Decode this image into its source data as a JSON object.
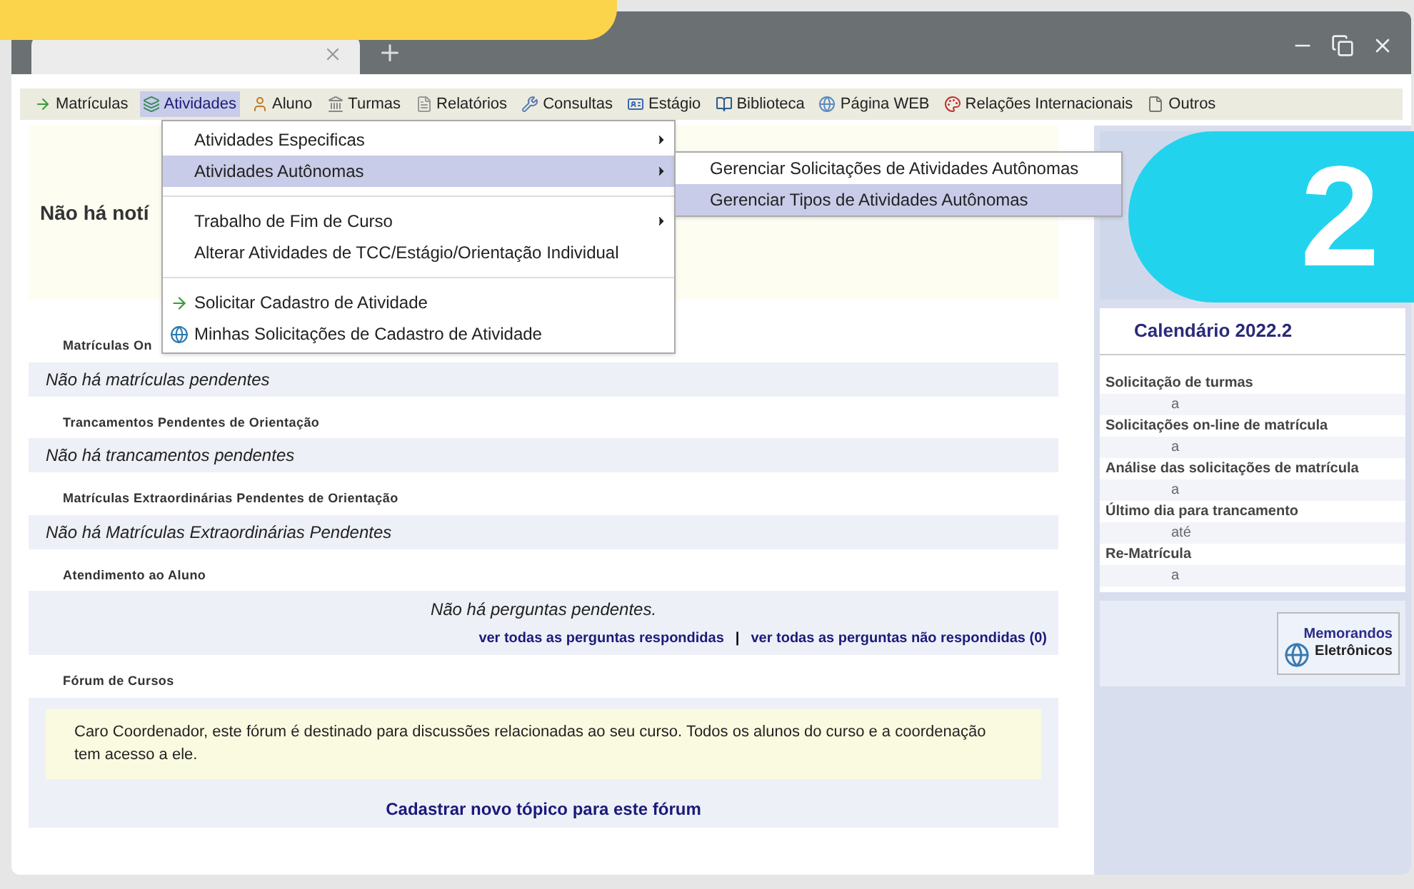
{
  "menu_bar": {
    "items": [
      {
        "label": "Matrículas",
        "selected": false
      },
      {
        "label": "Atividades",
        "selected": true
      },
      {
        "label": "Aluno",
        "selected": false
      },
      {
        "label": "Turmas",
        "selected": false
      },
      {
        "label": "Relatórios",
        "selected": false
      },
      {
        "label": "Consultas",
        "selected": false
      },
      {
        "label": "Estágio",
        "selected": false
      },
      {
        "label": "Biblioteca",
        "selected": false
      },
      {
        "label": "Página WEB",
        "selected": false
      },
      {
        "label": "Relações Internacionais",
        "selected": false
      },
      {
        "label": "Outros",
        "selected": false
      }
    ]
  },
  "dropdown": {
    "groups": [
      [
        {
          "label": "Atividades Especificas",
          "selected": false,
          "has_submenu": true,
          "kind": "text"
        },
        {
          "label": "Atividades Autônomas",
          "selected": true,
          "has_submenu": true,
          "kind": "text"
        }
      ],
      [
        {
          "label": "Trabalho de Fim de Curso",
          "selected": false,
          "has_submenu": true,
          "kind": "text"
        },
        {
          "label": "Alterar Atividades de TCC/Estágio/Orientação Individual",
          "selected": false,
          "has_submenu": false,
          "kind": "text"
        }
      ],
      [
        {
          "label": "Solicitar Cadastro de Atividade",
          "selected": false,
          "has_submenu": false,
          "kind": "icon"
        },
        {
          "label": "Minhas Solicitações de Cadastro de Atividade",
          "selected": false,
          "has_submenu": false,
          "kind": "icon"
        }
      ]
    ]
  },
  "submenu": {
    "items": [
      {
        "label": "Gerenciar Solicitações de Atividades Autônomas",
        "selected": false
      },
      {
        "label": "Gerenciar Tipos de Atividades Autônomas",
        "selected": true
      }
    ]
  },
  "notice": "Não há notí",
  "sections": [
    {
      "title": "Matrículas On",
      "kind": "row",
      "message": "Não há matrículas pendentes"
    },
    {
      "title": "Trancamentos Pendentes de Orientação",
      "kind": "row",
      "message": "Não há trancamentos pendentes"
    },
    {
      "title": "Matrículas Extraordinárias Pendentes de Orientação",
      "kind": "row",
      "message": "Não há Matrículas Extraordinárias Pendentes"
    },
    {
      "title": "Atendimento ao Aluno",
      "kind": "questions",
      "message": "Não há perguntas pendentes.",
      "links": [
        "ver todas as perguntas respondidas",
        "ver todas as perguntas não respondidas (0)"
      ],
      "separator": "|"
    },
    {
      "title": "Fórum de Cursos",
      "kind": "forum",
      "message": "Caro Coordenador, este fórum é destinado para discussões relacionadas ao seu curso. Todos os alunos do curso e a coordenação tem acesso a ele.",
      "links": [
        "Cadastrar novo tópico para este fórum"
      ]
    }
  ],
  "calendar": {
    "title": "Calendário 2022.2",
    "entries": [
      {
        "label": "Solicitação de turmas",
        "value": "a"
      },
      {
        "label": "Solicitações on-line de matrícula",
        "value": "a"
      },
      {
        "label": "Análise das solicitações de matrícula",
        "value": "a"
      },
      {
        "label": "Último dia para trancamento",
        "value": "até"
      },
      {
        "label": "Re-Matrícula",
        "value": "a"
      }
    ]
  },
  "memorandos": {
    "lines": [
      "Memorandos",
      "Eletrônicos"
    ]
  },
  "step_badge": "2"
}
